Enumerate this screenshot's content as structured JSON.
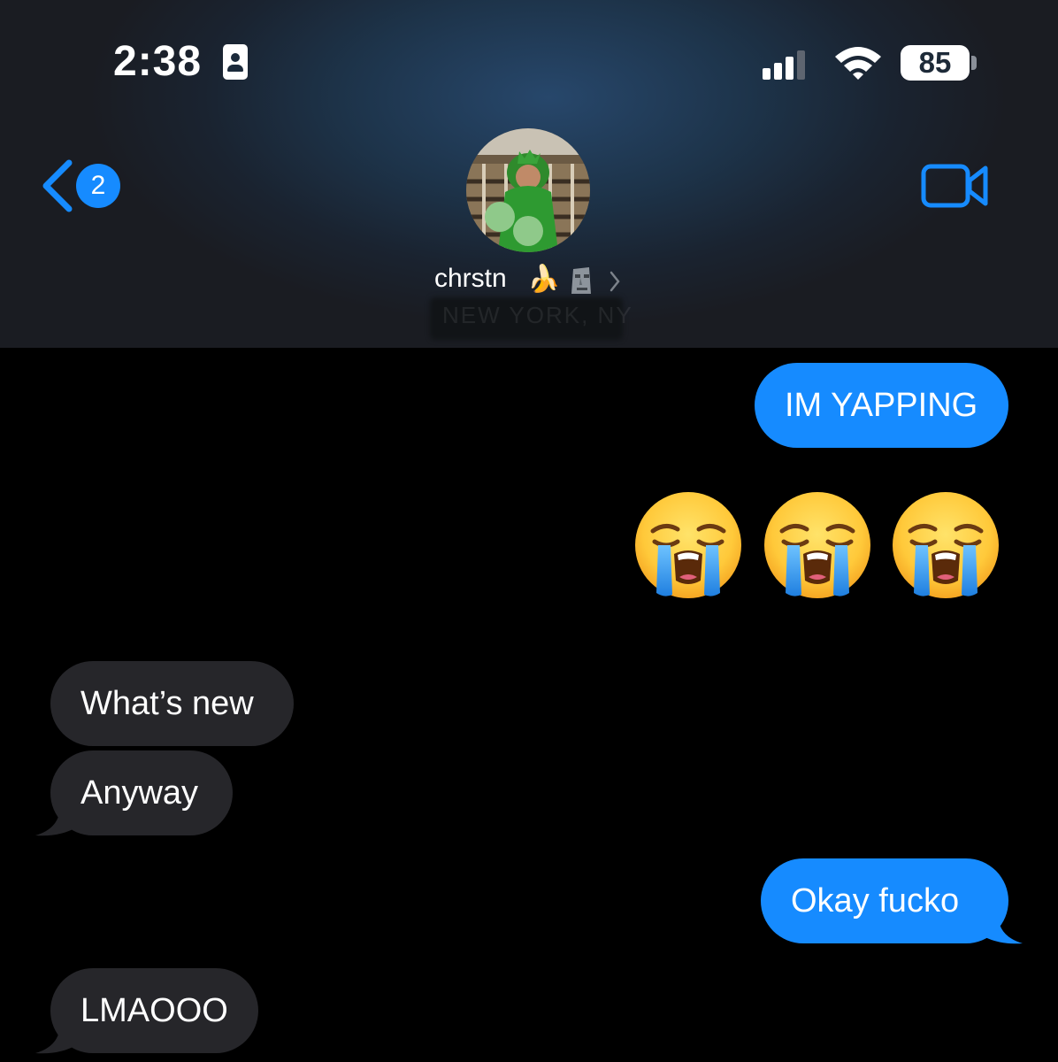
{
  "status_bar": {
    "time": "2:38",
    "battery": "85",
    "icons": [
      "contact-card-icon",
      "signal-icon",
      "wifi-icon",
      "battery-icon"
    ]
  },
  "header": {
    "back_badge_count": "2",
    "contact_name": "chrstn",
    "name_emojis": [
      "banana",
      "moai"
    ],
    "location": "NEW YORK, NY",
    "icons": [
      "back-chevron-icon",
      "video-call-icon",
      "chevron-right-icon"
    ]
  },
  "messages": [
    {
      "from": "me",
      "text": "IM YAPPING"
    },
    {
      "from": "me",
      "emoji": [
        "loudly-crying-face",
        "loudly-crying-face",
        "loudly-crying-face"
      ]
    },
    {
      "from": "them",
      "text": "What’s new"
    },
    {
      "from": "them",
      "text": "Anyway"
    },
    {
      "from": "me",
      "text": "Okay fucko"
    },
    {
      "from": "them",
      "text": "LMAOOO"
    }
  ],
  "colors": {
    "sent_bubble": "#168bff",
    "received_bubble": "#26262a",
    "accent": "#168bff",
    "background": "#000000"
  }
}
